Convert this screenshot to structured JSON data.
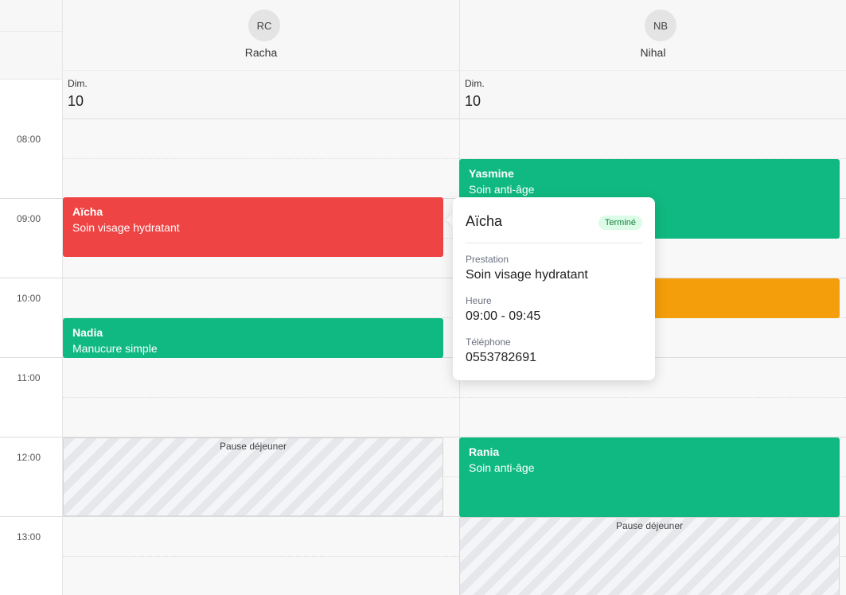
{
  "times": [
    "08:00",
    "09:00",
    "10:00",
    "11:00",
    "12:00",
    "13:00"
  ],
  "staff": [
    {
      "initials": "RC",
      "name": "Racha",
      "day_short": "Dim.",
      "day_number": "10"
    },
    {
      "initials": "NB",
      "name": "Nihal",
      "day_short": "Dim.",
      "day_number": "10"
    }
  ],
  "events": [
    {
      "client": "Aïcha",
      "service": "Soin visage hydratant",
      "status_color": "#ef4444"
    },
    {
      "client": "Nadia",
      "service": "Manucure simple",
      "status_color": "#10b981"
    },
    {
      "client": "Yasmine",
      "service": "Soin anti-âge",
      "status_color": "#10b981"
    },
    {
      "client": "Rania",
      "service": "Soin anti-âge",
      "status_color": "#10b981"
    }
  ],
  "breaks": [
    "Pause déjeuner",
    "Pause déjeuner"
  ],
  "popover": {
    "title": "Aïcha",
    "badge": "Terminé",
    "service_label": "Prestation",
    "service_value": "Soin visage hydratant",
    "time_label": "Heure",
    "time_value": "09:00 - 09:45",
    "phone_label": "Téléphone",
    "phone_value": "0553782691"
  },
  "colors": {
    "completed": "#10b981",
    "cancelled": "#ef4444",
    "pending": "#f59e0b"
  }
}
